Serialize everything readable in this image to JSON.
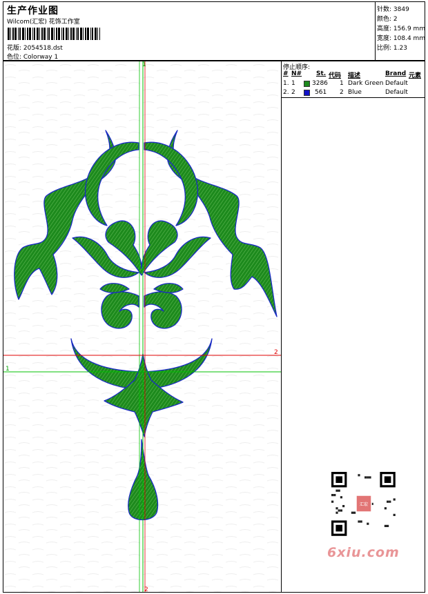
{
  "header": {
    "title": "生产作业图",
    "subtitle": "Wilcom(汇宏) 花饰工作室",
    "design_label": "花版: 2054518.dst",
    "colorway_label": "色位: Colorway 1"
  },
  "stats": [
    {
      "label": "针数:",
      "value": "3849"
    },
    {
      "label": "颜色:",
      "value": "2"
    },
    {
      "label": "高度:",
      "value": "156.9 mm"
    },
    {
      "label": "宽度:",
      "value": "108.4 mm"
    },
    {
      "label": "比例:",
      "value": "1.23"
    }
  ],
  "stop_sequence": {
    "title": "停止顺序:",
    "columns": [
      "#",
      "N#",
      "St.",
      "代码",
      "描述",
      "Brand",
      "元素"
    ],
    "rows": [
      {
        "num": "1.",
        "n": "1",
        "stitches": "3286",
        "code": "1",
        "description": "Dark Green",
        "brand": "Default",
        "color": "#1d8a1d"
      },
      {
        "num": "2.",
        "n": "2",
        "stitches": "561",
        "code": "2",
        "description": "Blue",
        "brand": "Default",
        "color": "#1212c8"
      }
    ]
  },
  "guides": {
    "vertical_top": "1",
    "vertical_bottom": "2",
    "horizontal_left": "1",
    "horizontal_right": "2"
  },
  "colors": {
    "green_fill": "#1d8a1d",
    "blue_outline": "#1a2bc4",
    "green_guide": "#00c000",
    "red_guide": "#e00000"
  },
  "watermark": {
    "brand": "6xiu.com",
    "stamp": "汇宏工作室"
  }
}
